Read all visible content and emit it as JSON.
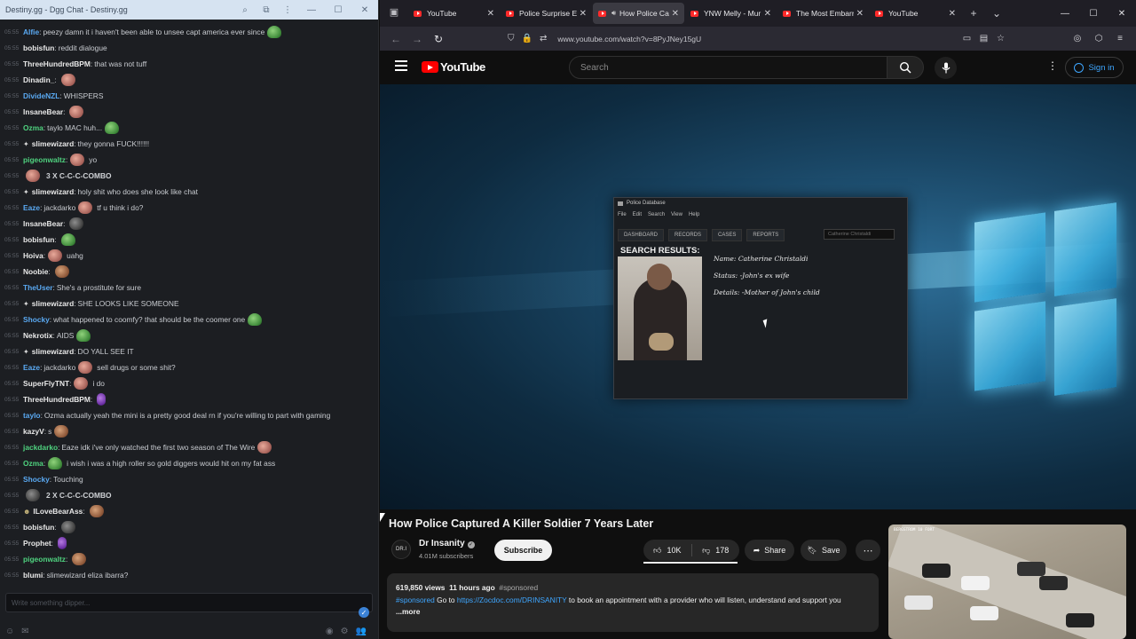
{
  "chat": {
    "window_title": "Destiny.gg - Dgg Chat - Destiny.gg",
    "lines": [
      {
        "ts": "05:55",
        "user": "Alfie",
        "color": "blue",
        "msg": "peezy damn it i haven't been able to unsee capt america ever since",
        "emote_after": "pepe"
      },
      {
        "ts": "05:55",
        "user": "bobisfun",
        "color": "white",
        "msg": "reddit dialogue"
      },
      {
        "ts": "05:55",
        "user": "ThreeHundredBPM",
        "color": "white",
        "msg": "that was not tuff"
      },
      {
        "ts": "05:55",
        "user": "Dinadin_",
        "color": "white",
        "msg": "",
        "emote_after": "pink"
      },
      {
        "ts": "05:55",
        "user": "DivideNZL",
        "color": "blue",
        "msg": "WHISPERS"
      },
      {
        "ts": "05:55",
        "user": "InsaneBear",
        "color": "white",
        "msg": "",
        "emote_after": "pink"
      },
      {
        "ts": "05:55",
        "user": "Ozma",
        "color": "green",
        "msg": "taylo MAC huh...",
        "emote_after": "pepe"
      },
      {
        "ts": "05:55",
        "user": "slimewizard",
        "color": "white",
        "star": true,
        "msg": "they gonna FUCK!!!!!!"
      },
      {
        "ts": "05:55",
        "user": "pigeonwaltz",
        "color": "green",
        "msg": "yo",
        "emote_before": "pink"
      },
      {
        "ts": "05:55",
        "combo": "3 X C-C-C-COMBO",
        "emote_before": "pink"
      },
      {
        "ts": "05:55",
        "user": "slimewizard",
        "color": "white",
        "star": true,
        "msg": "holy shit who does she look like chat"
      },
      {
        "ts": "05:55",
        "user": "Eaze",
        "color": "blue",
        "msg": "jackdarko",
        "emote_mid": "pink",
        "msg2": "tf u think i do?"
      },
      {
        "ts": "05:55",
        "user": "InsaneBear",
        "color": "white",
        "msg": "",
        "emote_after": "dark"
      },
      {
        "ts": "05:55",
        "user": "bobisfun",
        "color": "white",
        "msg": "",
        "emote_after": "pepe"
      },
      {
        "ts": "05:55",
        "user": "Hoiva",
        "color": "white",
        "msg": "uahg",
        "emote_before": "pink"
      },
      {
        "ts": "05:55",
        "user": "Noobie",
        "color": "white",
        "msg": "",
        "emote_after": "face"
      },
      {
        "ts": "05:55",
        "user": "TheUser",
        "color": "blue",
        "msg": "She's a prostitute for sure"
      },
      {
        "ts": "05:55",
        "user": "slimewizard",
        "color": "white",
        "star": true,
        "msg": "SHE LOOKS LIKE SOMEONE"
      },
      {
        "ts": "05:55",
        "user": "Shocky",
        "color": "blue",
        "msg": "what happened to coomfy? that should be the coomer one",
        "emote_after": "pepe"
      },
      {
        "ts": "05:55",
        "user": "Nekrotix",
        "color": "white",
        "msg": "AIDS",
        "emote_after": "pepe"
      },
      {
        "ts": "05:55",
        "user": "slimewizard",
        "color": "white",
        "star": true,
        "msg": "DO YALL SEE IT"
      },
      {
        "ts": "05:55",
        "user": "Eaze",
        "color": "blue",
        "msg": "jackdarko",
        "emote_mid": "pink",
        "msg2": "sell drugs or some shit?"
      },
      {
        "ts": "05:55",
        "user": "SuperFlyTNT",
        "color": "white",
        "msg": "i do",
        "emote_before": "pink"
      },
      {
        "ts": "05:55",
        "user": "ThreeHundredBPM",
        "color": "white",
        "msg": "",
        "emote_after": "purple"
      },
      {
        "ts": "05:55",
        "user": "taylo",
        "color": "blue",
        "msg": "Ozma actually yeah the mini is a pretty good deal rn if you're willing to part with gaming"
      },
      {
        "ts": "05:55",
        "user": "kazyV",
        "color": "white",
        "msg": "s",
        "emote_after": "face"
      },
      {
        "ts": "05:55",
        "user": "jackdarko",
        "color": "green",
        "msg": "Eaze idk i've only watched the first two season of The Wire",
        "emote_after": "pink"
      },
      {
        "ts": "05:55",
        "user": "Ozma",
        "color": "green",
        "msg": "i wish i was a high roller so gold diggers would hit on my fat ass",
        "emote_before": "pepe"
      },
      {
        "ts": "05:55",
        "user": "Shocky",
        "color": "blue",
        "msg": "Touching"
      },
      {
        "ts": "05:55",
        "combo": "2 X C-C-C-COMBO",
        "emote_before": "dark"
      },
      {
        "ts": "05:55",
        "user": "ILoveBearAss",
        "color": "white",
        "badge": true,
        "msg": "",
        "emote_after": "face"
      },
      {
        "ts": "05:55",
        "user": "bobisfun",
        "color": "white",
        "msg": "",
        "emote_after": "dark"
      },
      {
        "ts": "05:55",
        "user": "Prophet",
        "color": "white",
        "msg": "",
        "emote_after": "purple"
      },
      {
        "ts": "05:55",
        "user": "pigeonwaltz",
        "color": "green",
        "msg": "",
        "emote_after": "face"
      },
      {
        "ts": "05:55",
        "user": "blumi",
        "color": "white",
        "msg": "slimewizard eliza ibarra?"
      }
    ],
    "input_placeholder": "Write something dipper..."
  },
  "browser": {
    "tabs": [
      {
        "title": "YouTube",
        "active": false,
        "audio": false
      },
      {
        "title": "Police Surprise Em",
        "active": false,
        "audio": false
      },
      {
        "title": "How Police Ca",
        "active": true,
        "audio": true
      },
      {
        "title": "YNW Melly - Mur",
        "active": false,
        "audio": false
      },
      {
        "title": "The Most Embarr",
        "active": false,
        "audio": false
      },
      {
        "title": "YouTube",
        "active": false,
        "audio": false
      }
    ],
    "url": "www.youtube.com/watch?v=8PyJNey15gU"
  },
  "youtube": {
    "logo_text": "YouTube",
    "search_placeholder": "Search",
    "sign_in": "Sign in",
    "video": {
      "window_title": "Police Database",
      "menu": [
        "File",
        "Edit",
        "Search",
        "View",
        "Help"
      ],
      "tabs": [
        "DASHBOARD",
        "RECORDS",
        "CASES",
        "REPORTS"
      ],
      "search_value": "Catherine Christaldi",
      "heading": "SEARCH RESULTS:",
      "name_line": "Name: Catherine Christaldi",
      "status_line": "Status: -John's ex wife",
      "details_line": "Details: -Mother of John's child",
      "thumb_hud": "BERGSTROM 10 FORT"
    },
    "title": "How Police Captured A Killer Soldier 7 Years Later",
    "channel": {
      "name": "Dr Insanity",
      "subs": "4.01M subscribers",
      "avatar_text": "DR.I"
    },
    "subscribe": "Subscribe",
    "likes": "10K",
    "dislikes": "178",
    "share": "Share",
    "save": "Save",
    "description": {
      "views": "619,850 views",
      "age": "11 hours ago",
      "tag_top": "#sponsored",
      "tag": "#sponsored",
      "text1": "Go to",
      "link": "https://Zocdoc.com/DRINSANITY",
      "text2": "to book an appointment with a provider who will listen, understand and support you",
      "more": "...more"
    }
  },
  "colors": {
    "accent_blue": "#3ea6ff",
    "yt_red": "#ff0000",
    "chat_bg": "#1c1e22"
  }
}
